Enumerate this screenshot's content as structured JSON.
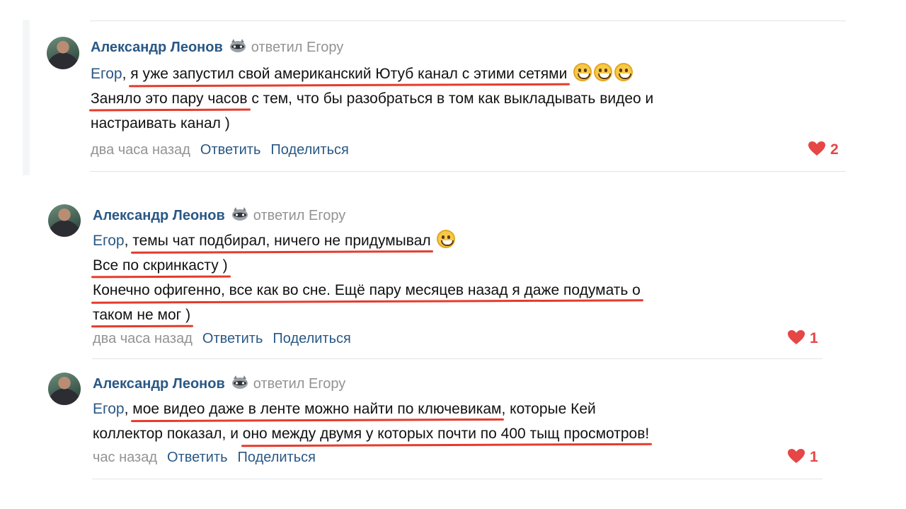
{
  "comments": [
    {
      "author": "Александр Леонов",
      "replied": "ответил Егору",
      "mention": "Егор",
      "lines": [
        [
          ", ",
          {
            "u": "я уже запустил свой американский Ютуб канал с этими сетями"
          },
          " "
        ],
        [
          {
            "u": "Заняло это пару часов"
          },
          " с тем, что бы разобраться в том как выкладывать видео и"
        ],
        [
          "настраивать канал )"
        ]
      ],
      "emojis_line0": 3,
      "time": "два часа назад",
      "reply": "Ответить",
      "share": "Поделиться",
      "likes": "2"
    },
    {
      "author": "Александр Леонов",
      "replied": "ответил Егору",
      "mention": "Егор",
      "lines": [
        [
          ", ",
          {
            "u": "темы чат подбирал, ничего не придумывал"
          },
          " "
        ],
        [
          {
            "u": "Все по скринкасту )"
          }
        ],
        [
          {
            "u": "Конечно офигенно, все как во сне. Ещё пару месяцев назад я даже подумать о"
          }
        ],
        [
          {
            "u": "таком не мог )"
          }
        ]
      ],
      "emojis_line0": 1,
      "time": "два часа назад",
      "reply": "Ответить",
      "share": "Поделиться",
      "likes": "1"
    },
    {
      "author": "Александр Леонов",
      "replied": "ответил Егору",
      "mention": "Егор",
      "lines": [
        [
          ", ",
          {
            "u": "мое видео даже в ленте можно найти по ключевикам"
          },
          ", которые Кей"
        ],
        [
          "коллектор показал, и ",
          {
            "u": "оно между двумя у которых почти по 400 тыщ просмотров!"
          }
        ]
      ],
      "emojis_line0": 0,
      "time": "час назад",
      "reply": "Ответить",
      "share": "Поделиться",
      "likes": "1"
    }
  ],
  "colors": {
    "link": "#2a5885",
    "muted": "#939393",
    "like": "#e64646",
    "underline": "#e53b2c"
  },
  "icons": {
    "like": "heart-icon",
    "badge": "raccoon-icon",
    "emoji": "grinning-emoji-icon"
  }
}
